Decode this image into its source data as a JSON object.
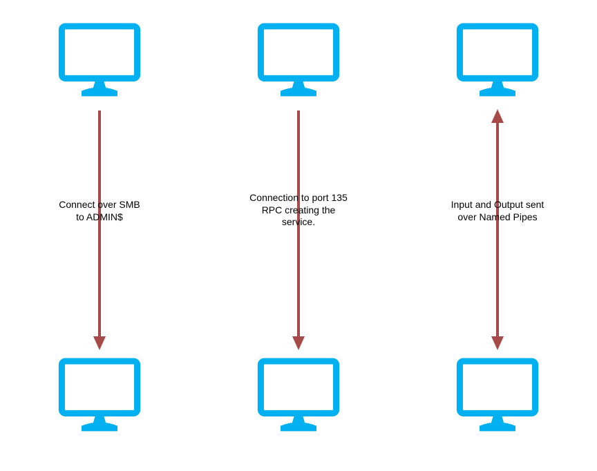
{
  "columns": [
    {
      "label": "Connect over SMB\nto ADMIN$",
      "arrow": "down"
    },
    {
      "label": "Connection to port 135\nRPC creating the\nservice.",
      "arrow": "down"
    },
    {
      "label": "Input and Output sent\nover Named Pipes",
      "arrow": "both"
    }
  ],
  "colors": {
    "monitor": "#00b0f0",
    "arrow": "#a74a4a"
  }
}
